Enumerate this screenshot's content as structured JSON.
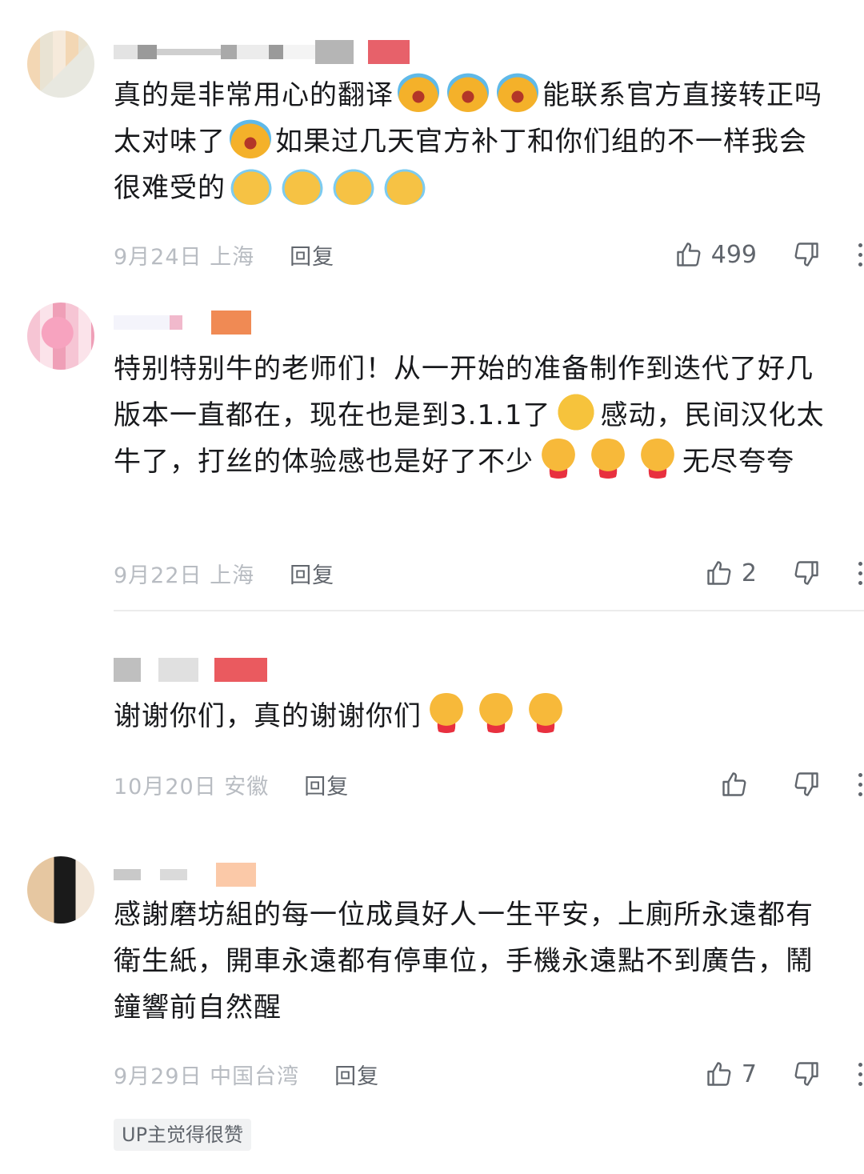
{
  "comments": [
    {
      "text_parts": [
        "真的是非常用心的翻译",
        "能联系官方直接转正吗太对味了",
        "如果过几天官方补丁和你们组的不一样我会很难受的"
      ],
      "date_location": "9月24日 上海",
      "reply_label": "回复",
      "likes": "499"
    },
    {
      "text_parts": [
        "特别特别牛的老师们！从一开始的准备制作到迭代了好几版本一直都在，现在也是到3.1.1了",
        "感动，民间汉化太牛了，打丝的体验感也是好了不少",
        "无尽夸夸"
      ],
      "date_location": "9月22日 上海",
      "reply_label": "回复",
      "likes": "2"
    },
    {
      "text_parts": [
        "谢谢你们，真的谢谢你们"
      ],
      "date_location": "10月20日 安徽",
      "reply_label": "回复",
      "likes": ""
    },
    {
      "text_parts": [
        "感謝磨坊組的每一位成員好人一生平安，上廁所永遠都有衛生紙，開車永遠都有停車位，手機永遠點不到廣告，鬧鐘響前自然醒"
      ],
      "date_location": "9月29日 中国台湾",
      "reply_label": "回复",
      "likes": "7",
      "badge": "UP主觉得很赞"
    }
  ],
  "icons": {
    "like": "thumbs-up-icon",
    "dislike": "thumbs-down-icon",
    "more": "more-vertical-icon",
    "emoji_cry_big": "loud-crying-emoji",
    "emoji_cry_small": "crying-emoji",
    "emoji_heart_hug": "heart-hug-emoji",
    "emoji_wow": "starry-eyes-emoji"
  },
  "colors": {
    "text": "#18191c",
    "secondary": "#61666d",
    "muted": "#b8bcc2",
    "badge_bg": "#f1f2f3"
  }
}
